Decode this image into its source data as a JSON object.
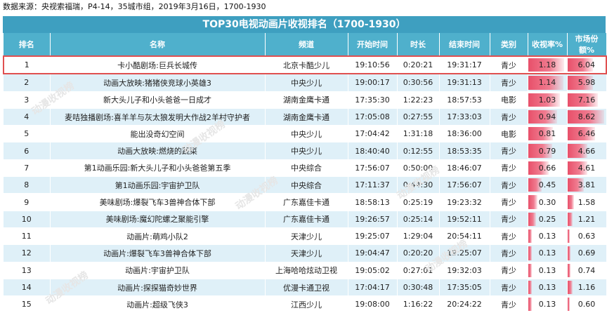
{
  "source_text": "数据来源：央视索福瑞，P4-14，35城市组，2019年3月16日，1700-1930",
  "title": "TOP30电视动画片收视排名（1700-1930）",
  "headers": [
    "排名",
    "名称",
    "频道",
    "开始时间",
    "时长",
    "结束时间",
    "类别",
    "收视率%",
    "市场份额%"
  ],
  "rows": [
    {
      "rank": "1",
      "name": "卡小酷剧场:巨兵长城传",
      "channel": "北京卡酷少儿",
      "start": "19:10:56",
      "duration": "0:20:21",
      "end": "19:31:17",
      "category": "青少",
      "rating": "1.18",
      "share": "6.04"
    },
    {
      "rank": "2",
      "name": "动画大放映:猪猪侠竞球小英雄3",
      "channel": "中央少儿",
      "start": "19:00:17",
      "duration": "0:30:56",
      "end": "19:31:13",
      "category": "青少",
      "rating": "1.14",
      "share": "5.98"
    },
    {
      "rank": "3",
      "name": "新大头儿子和小头爸爸一日成才",
      "channel": "湖南金鹰卡通",
      "start": "17:35:30",
      "duration": "1:22:23",
      "end": "18:57:53",
      "category": "电影",
      "rating": "1.03",
      "share": "7.16"
    },
    {
      "rank": "4",
      "name": "麦咭独播剧场:喜羊羊与灰太狼发明大作战2羊村守护者",
      "channel": "湖南金鹰卡通",
      "start": "17:05:08",
      "duration": "0:27:55",
      "end": "17:33:03",
      "category": "青少",
      "rating": "0.94",
      "share": "8.62"
    },
    {
      "rank": "5",
      "name": "能出没奇幻空间",
      "channel": "中央少儿",
      "start": "17:04:42",
      "duration": "1:31:18",
      "end": "18:36:00",
      "category": "电影",
      "rating": "0.81",
      "share": "6.46"
    },
    {
      "rank": "6",
      "name": "动画大放映:燃烧的蔬菜",
      "channel": "中央少儿",
      "start": "18:40:40",
      "duration": "0:12:55",
      "end": "18:53:35",
      "category": "青少",
      "rating": "0.79",
      "share": "4.66"
    },
    {
      "rank": "7",
      "name": "第1动画乐园:新大头儿子和小头爸爸第五季",
      "channel": "中央综合",
      "start": "17:56:07",
      "duration": "0:50:00",
      "end": "18:46:07",
      "category": "青少",
      "rating": "0.66",
      "share": "4.61"
    },
    {
      "rank": "8",
      "name": "第1动画乐园:宇宙护卫队",
      "channel": "中央综合",
      "start": "17:11:37",
      "duration": "0:44:30",
      "end": "17:56:07",
      "category": "青少",
      "rating": "0.45",
      "share": "3.81"
    },
    {
      "rank": "9",
      "name": "美味剧场:爆裂飞车3兽神合体下部",
      "channel": "广东嘉佳卡通",
      "start": "18:58:13",
      "duration": "0:25:19",
      "end": "19:23:32",
      "category": "青少",
      "rating": "0.30",
      "share": "1.58"
    },
    {
      "rank": "10",
      "name": "美味剧场:魔幻陀螺之聚能引擎",
      "channel": "广东嘉佳卡通",
      "start": "19:26:57",
      "duration": "0:25:14",
      "end": "19:52:11",
      "category": "青少",
      "rating": "0.25",
      "share": "1.21"
    },
    {
      "rank": "11",
      "name": "动画片:萌鸡小队2",
      "channel": "天津少儿",
      "start": "19:25:07",
      "duration": "1:29:04",
      "end": "20:54:11",
      "category": "青少",
      "rating": "0.13",
      "share": "0.63"
    },
    {
      "rank": "12",
      "name": "动画片:爆裂飞车3兽神合体下部",
      "channel": "天津少儿",
      "start": "19:04:47",
      "duration": "0:20:20",
      "end": "19:25:07",
      "category": "青少",
      "rating": "0.13",
      "share": "0.69"
    },
    {
      "rank": "13",
      "name": "动画片:宇宙护卫队",
      "channel": "上海哈哈炫动卫视",
      "start": "19:05:02",
      "duration": "0:27:01",
      "end": "19:32:03",
      "category": "青少",
      "rating": "0.13",
      "share": "0.74"
    },
    {
      "rank": "14",
      "name": "动画片:探探猫奇妙世界",
      "channel": "优漫卡通卫视",
      "start": "17:04:17",
      "duration": "0:30:48",
      "end": "17:35:05",
      "category": "青少",
      "rating": "0.13",
      "share": "1.16"
    },
    {
      "rank": "15",
      "name": "动画片:超级飞侠3",
      "channel": "江西少儿",
      "start": "19:08:00",
      "duration": "1:16:22",
      "end": "20:24:22",
      "category": "青少",
      "rating": "0.13",
      "share": "0.60"
    }
  ],
  "bar_max": {
    "rating": 1.25,
    "share": 9.0
  },
  "watermark_text": "动漫收视榜",
  "colors": {
    "title_bg": "#3e9fc0",
    "header_bg": "#4fb0cc",
    "stripe": "#dff0f8",
    "bar": "#e8506a",
    "highlight": "#e05050"
  }
}
